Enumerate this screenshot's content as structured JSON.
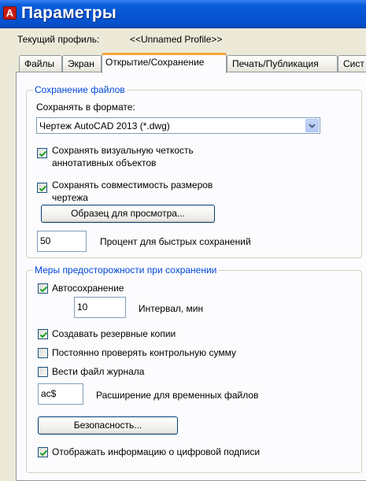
{
  "window": {
    "title": "Параметры",
    "icon": "autocad-logo-icon",
    "icon_glyph": "A"
  },
  "profile": {
    "label": "Текущий профиль:",
    "value": "<<Unnamed Profile>>"
  },
  "tabs": [
    {
      "label": "Файлы",
      "active": false
    },
    {
      "label": "Экран",
      "active": false
    },
    {
      "label": "Открытие/Сохранение",
      "active": true
    },
    {
      "label": "Печать/Публикация",
      "active": false
    },
    {
      "label": "Сист",
      "active": false
    }
  ],
  "file_save": {
    "title": "Сохранение файлов",
    "format_label": "Сохранять в формате:",
    "format_value": "Чертеж AutoCAD 2013 (*.dwg)",
    "visual_fidelity": {
      "label_line1": "Сохранять визуальную четкость",
      "label_line2": "аннотативных объектов",
      "checked": true
    },
    "size_compat": {
      "label_line1": "Сохранять совместимость размеров",
      "label_line2": "чертежа",
      "checked": true
    },
    "thumbnail_button": "Образец для просмотра...",
    "incremental_value": "50",
    "incremental_label": "Процент для быстрых сохранений"
  },
  "safety": {
    "title": "Меры предосторожности при сохранении",
    "autosave": {
      "label": "Автосохранение",
      "checked": true
    },
    "interval_value": "10",
    "interval_label": "Интервал, мин",
    "backup": {
      "label": "Создавать резервные копии",
      "checked": true
    },
    "crc": {
      "label": "Постоянно проверять контрольную сумму",
      "checked": false
    },
    "logfile": {
      "label": "Вести файл журнала",
      "checked": false
    },
    "temp_ext_value": "ac$",
    "temp_ext_label": "Расширение для временных файлов",
    "security_button": "Безопасность...",
    "digital_sig": {
      "label": "Отображать информацию о цифровой подписи",
      "checked": true
    }
  },
  "colors": {
    "title_bar": "#0654d4",
    "group_title": "#0046d5",
    "active_tab_accent": "#f2a53b",
    "dialog_bg": "#ece9d8"
  }
}
